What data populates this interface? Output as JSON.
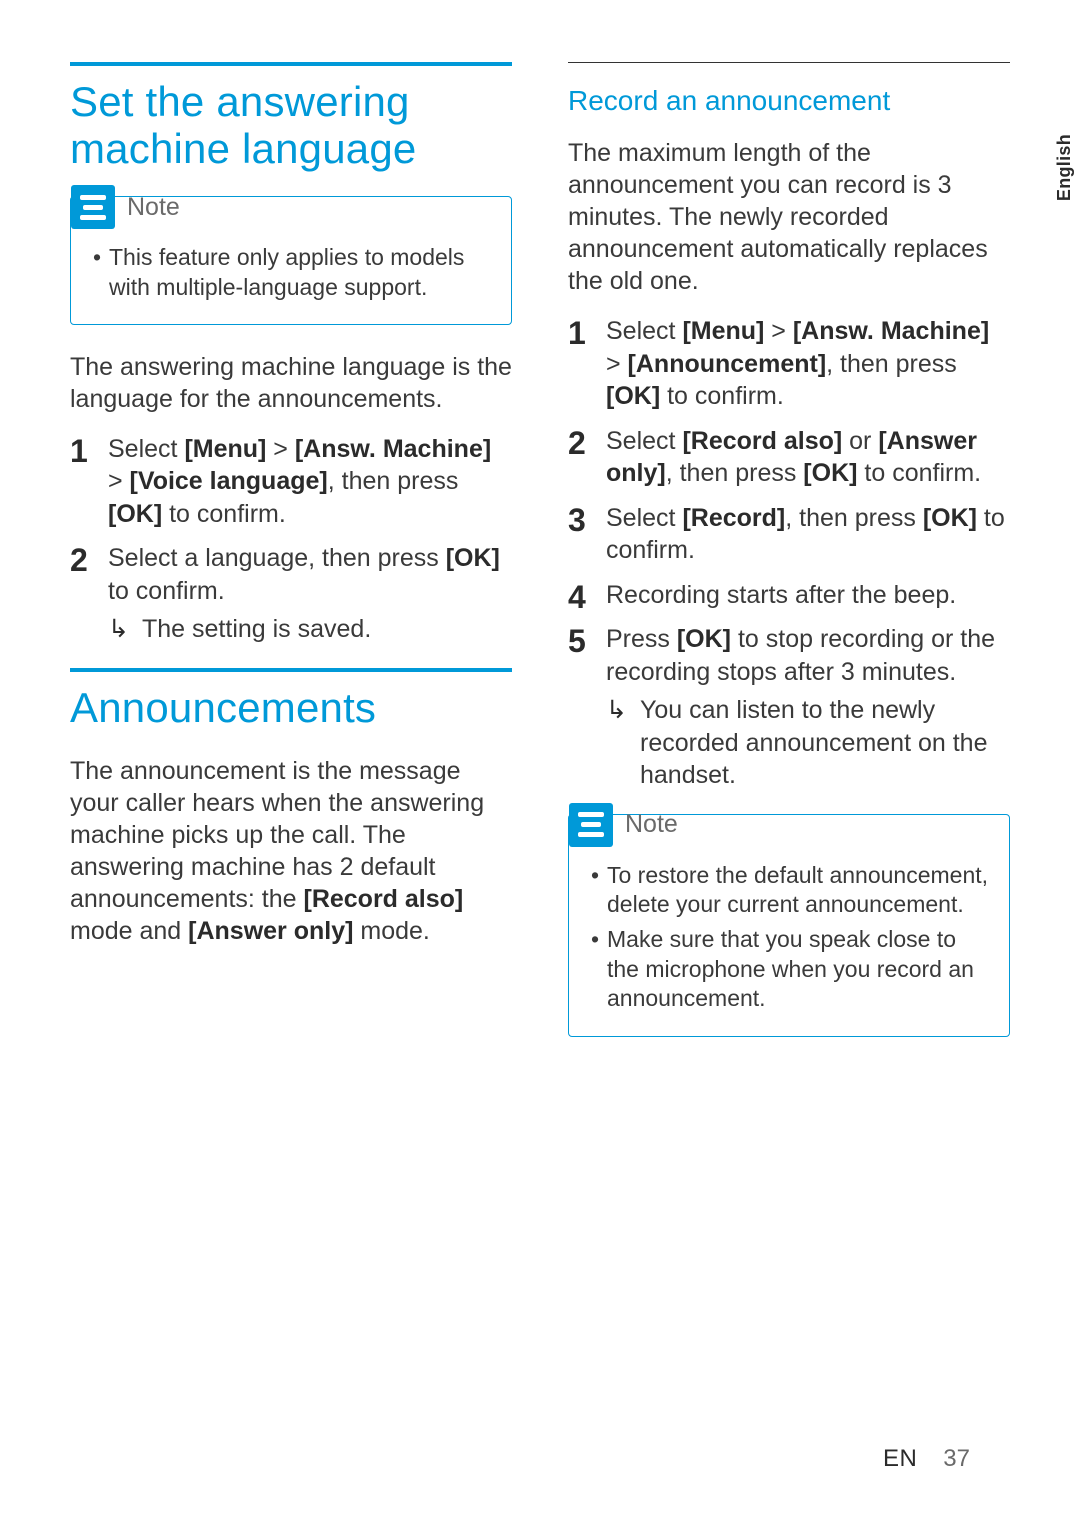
{
  "sideTab": "English",
  "footer": {
    "lang": "EN",
    "page": "37"
  },
  "left": {
    "heading1": "Set the answering machine language",
    "note1": {
      "label": "Note",
      "items": [
        "This feature only applies to models with multiple-language support."
      ]
    },
    "para1": "The answering machine language is the language for the announcements.",
    "steps1": [
      {
        "pre": "Select ",
        "b1": "[Menu]",
        "mid1": " > ",
        "b2": "[Answ. Machine]",
        "mid2": " > ",
        "b3": "[Voice language]",
        "post": ", then press ",
        "b4": "[OK]",
        "tail": " to confirm."
      },
      {
        "pre": "Select a language, then press ",
        "b1": "[OK]",
        "post": " to confirm.",
        "result": "The setting is saved."
      }
    ],
    "heading2": "Announcements",
    "para2_pre": "The announcement is the message your caller hears when the answering machine picks up the call. The answering machine has 2 default announcements: the ",
    "para2_b1": "[Record also]",
    "para2_mid": " mode and ",
    "para2_b2": "[Answer only]",
    "para2_post": " mode."
  },
  "right": {
    "sub1": "Record an announcement",
    "para1": "The maximum length of the announcement you can record is 3 minutes. The newly recorded announcement automatically replaces the old one.",
    "steps1": [
      {
        "pre": "Select ",
        "b1": "[Menu]",
        "mid1": " > ",
        "b2": "[Answ. Machine]",
        "mid2": " > ",
        "b3": "[Announcement]",
        "post": ", then press ",
        "b4": "[OK]",
        "tail": " to confirm."
      },
      {
        "pre": "Select ",
        "b1": "[Record also]",
        "mid1": " or ",
        "b2": "[Answer only]",
        "post": ", then press ",
        "b3": "[OK]",
        "tail": " to confirm."
      },
      {
        "pre": "Select ",
        "b1": "[Record]",
        "post": ", then press ",
        "b2": "[OK]",
        "tail": " to confirm."
      },
      {
        "pre": "Recording starts after the beep."
      },
      {
        "pre": "Press ",
        "b1": "[OK]",
        "post": " to stop recording or the recording stops after 3 minutes.",
        "result": "You can listen to the newly recorded announcement on the handset."
      }
    ],
    "note1": {
      "label": "Note",
      "items": [
        "To restore the default announcement, delete your current announcement.",
        "Make sure that you speak close to the microphone when you record an announcement."
      ]
    }
  }
}
